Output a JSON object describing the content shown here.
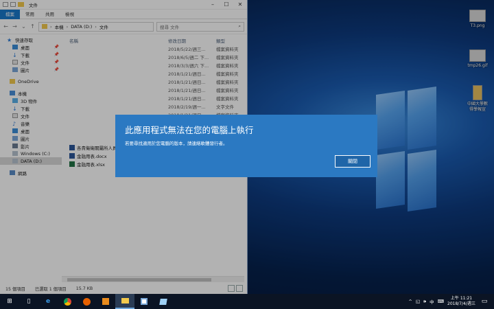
{
  "explorer": {
    "title": "文件",
    "ribbon_tabs": [
      "檔案",
      "常用",
      "共用",
      "檢視"
    ],
    "address": {
      "this_pc": "本機",
      "drive": "DATA (D:)",
      "folder": "文件"
    },
    "search_placeholder": "搜尋 文件",
    "columns": {
      "name": "名稱",
      "date": "修改日期",
      "type": "類型"
    },
    "nav": {
      "quick_access": "快速存取",
      "quick_items": [
        "桌面",
        "下載",
        "文件",
        "圖片"
      ],
      "onedrive": "OneDrive",
      "this_pc": "本機",
      "pc_items": [
        "3D 物件",
        "下載",
        "文件",
        "音樂",
        "桌面",
        "圖片",
        "影片",
        "Windows (C:)",
        "DATA (D:)"
      ],
      "network": "網路"
    },
    "files": [
      {
        "date": "2018/5/22/週三...",
        "type": "檔案資料夾"
      },
      {
        "date": "2018/6/5/週二 下...",
        "type": "檔案資料夾"
      },
      {
        "date": "2018/3/3/週六 下...",
        "type": "檔案資料夾"
      },
      {
        "date": "2018/1/21/週日...",
        "type": "檔案資料夾"
      },
      {
        "date": "2018/1/21/週日...",
        "type": "檔案資料夾"
      },
      {
        "date": "2018/1/21/週日...",
        "type": "檔案資料夾"
      },
      {
        "date": "2018/1/21/週日...",
        "type": "檔案資料夾"
      },
      {
        "date": "2018/2/19/週一...",
        "type": "文字文件"
      },
      {
        "date": "2018/1/21/週日...",
        "type": "檔案資料夾"
      }
    ],
    "visible_files": [
      {
        "name": "各貴衛衛關屬所人員",
        "icon": "word"
      },
      {
        "name": "金融用表.docx",
        "icon": "word"
      },
      {
        "name": "金融用表.xlsx",
        "icon": "excel"
      }
    ],
    "status": {
      "count": "15 個項目",
      "selected": "已選取 1 個項目",
      "size": "15.7 KB"
    }
  },
  "dialog": {
    "title": "此應用程式無法在您的電腦上執行",
    "message": "若要尋找適用於您電腦的版本，請連絡軟體發行者。",
    "close_label": "關閉"
  },
  "desktop_icons": [
    {
      "label": "T3.png"
    },
    {
      "label": "tmp26.gif"
    },
    {
      "label": "中國大學數\n得學報宣"
    }
  ],
  "taskbar": {
    "time": "上午 11:21",
    "date": "2018/7/4/週三",
    "ime": "中"
  }
}
